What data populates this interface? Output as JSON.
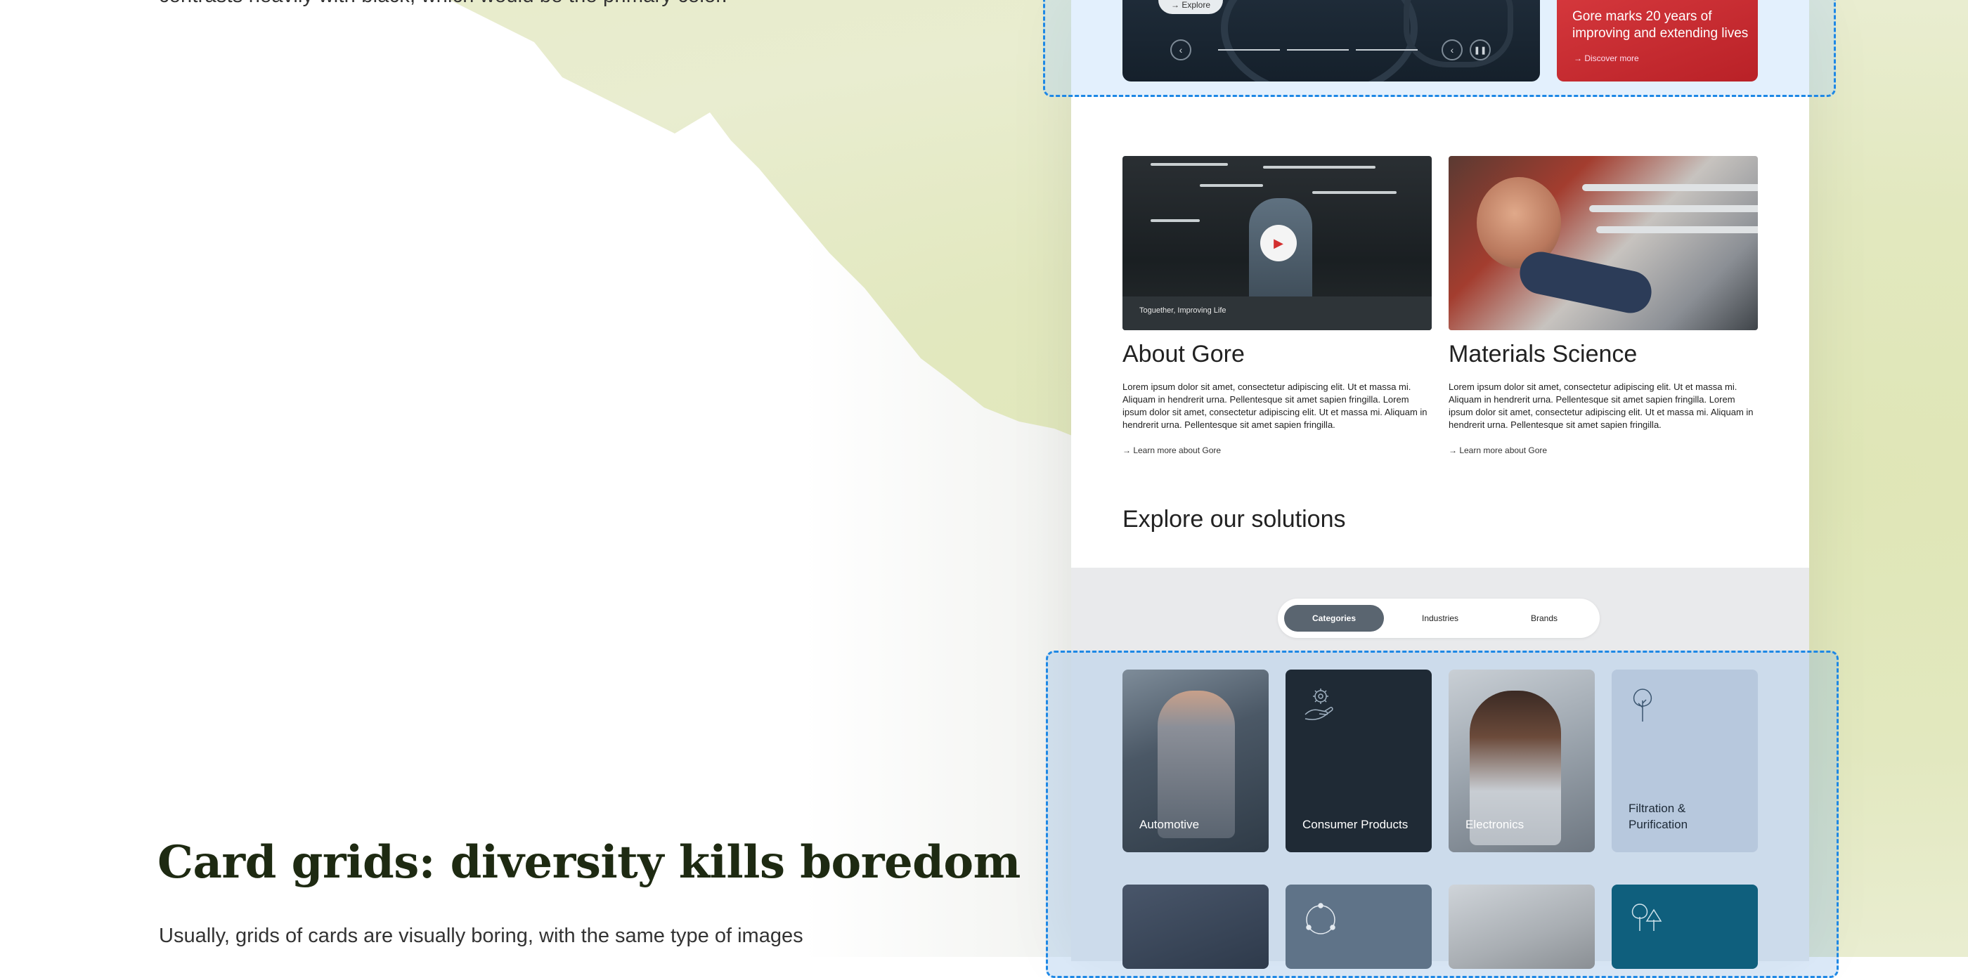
{
  "article": {
    "intro_line": "contrasts heavily with black, which would be the primary color.",
    "heading": "Card grids: diversity kills boredom",
    "body_line": "Usually, grids of cards are visually boring, with the same type of images"
  },
  "hero": {
    "explore_label": "→ Explore",
    "prev_icon": "chevron-left-icon",
    "next_icon": "chevron-left-icon",
    "pause_icon": "pause-icon",
    "promo_title": "Gore marks 20 years of improving and extending lives",
    "promo_link": "→  Discover more"
  },
  "features": [
    {
      "title": "About Gore",
      "video_caption": "Toguether, Improving Life",
      "text": "Lorem ipsum dolor sit amet, consectetur adipiscing elit. Ut et massa mi. Aliquam in hendrerit urna. Pellentesque sit amet sapien fringilla. Lorem ipsum dolor sit amet, consectetur adipiscing elit. Ut et massa mi. Aliquam in hendrerit urna. Pellentesque sit amet sapien fringilla.",
      "link": "→  Learn more about Gore"
    },
    {
      "title": "Materials Science",
      "text": "Lorem ipsum dolor sit amet, consectetur adipiscing elit. Ut et massa mi. Aliquam in hendrerit urna. Pellentesque sit amet sapien fringilla. Lorem ipsum dolor sit amet, consectetur adipiscing elit. Ut et massa mi. Aliquam in hendrerit urna. Pellentesque sit amet sapien fringilla.",
      "link": "→  Learn more about Gore"
    }
  ],
  "solutions": {
    "heading": "Explore our solutions",
    "tabs": [
      "Categories",
      "Industries",
      "Brands"
    ],
    "active_tab": "Categories",
    "cards": [
      {
        "label": "Automotive",
        "style": "photo"
      },
      {
        "label": "Consumer Products",
        "style": "dark",
        "icon": "hand-gear-icon"
      },
      {
        "label": "Electronics",
        "style": "photo"
      },
      {
        "label": "Filtration & Purification",
        "style": "light",
        "icon": "tree-icon"
      }
    ]
  },
  "colors": {
    "accent_red": "#c62828",
    "highlight_blue": "#1e88e5",
    "dark_navy": "#1f2a35",
    "teal": "#0f5f7d",
    "heading_green": "#1e2a12"
  }
}
